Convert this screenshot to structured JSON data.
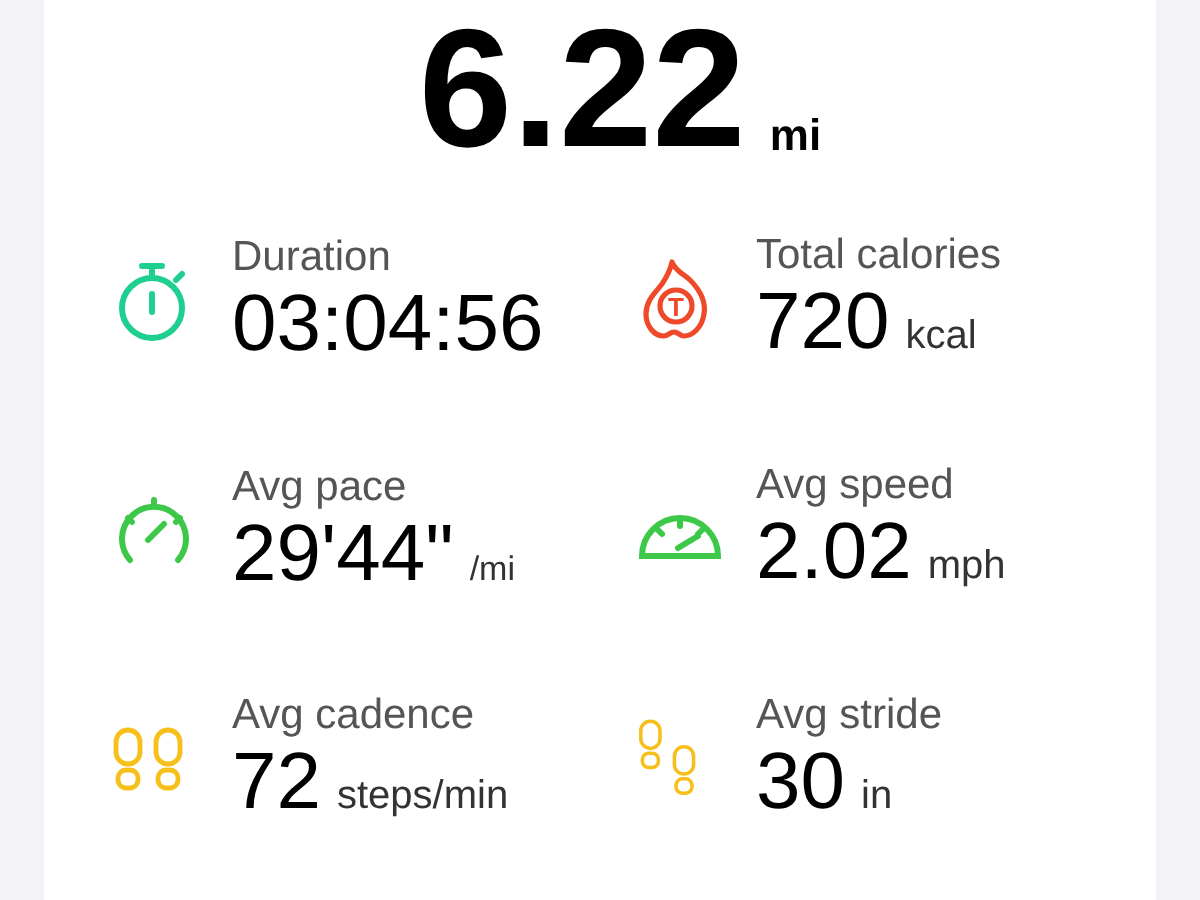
{
  "distance": {
    "value": "6.22",
    "unit": "mi"
  },
  "stats": [
    {
      "kind": "stopwatch",
      "color": "#1fcf8f",
      "label": "Duration",
      "value": "03:04:56"
    },
    {
      "kind": "flame",
      "color": "#ee4a2a",
      "label": "Total calories",
      "value": "720",
      "unit": "kcal",
      "badge": "T"
    },
    {
      "kind": "gauge",
      "color": "#3ec84a",
      "label": "Avg pace",
      "value": "29'44\"",
      "unit": "/mi"
    },
    {
      "kind": "speedometer",
      "color": "#3ec84a",
      "label": "Avg speed",
      "value": "2.02",
      "unit": "mph"
    },
    {
      "kind": "footprints",
      "color": "#f7bf1a",
      "label": "Avg cadence",
      "value": "72",
      "unit": "steps/min"
    },
    {
      "kind": "footprints-small",
      "color": "#f7bf1a",
      "label": "Avg stride",
      "value": "30",
      "unit": "in"
    }
  ]
}
